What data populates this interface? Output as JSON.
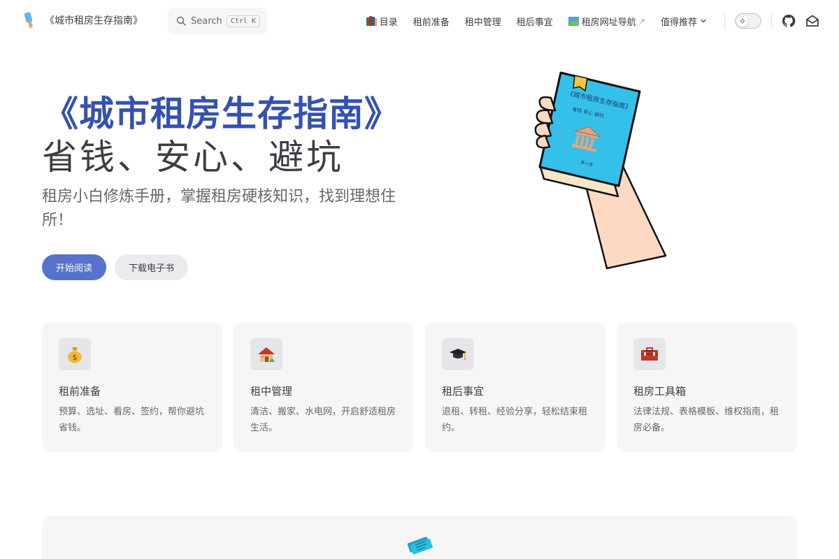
{
  "site": {
    "title": "《城市租房生存指南》"
  },
  "search": {
    "label": "Search",
    "shortcut": "Ctrl K"
  },
  "nav": {
    "items": [
      {
        "label": "目录",
        "icon": "books-emoji-icon"
      },
      {
        "label": "租前准备"
      },
      {
        "label": "租中管理"
      },
      {
        "label": "租后事宜"
      },
      {
        "label": "租房网址导航",
        "icon": "map-emoji-icon",
        "external": "↗"
      },
      {
        "label": "值得推荐",
        "icon": "chevron-down-icon"
      }
    ]
  },
  "hero": {
    "name": "《城市租房生存指南》",
    "text": "省钱、安心、避坑",
    "tagline": "租房小白修炼手册，掌握租房硬核知识，找到理想住所！",
    "actions": [
      {
        "label": "开始阅读"
      },
      {
        "label": "下载电子书"
      }
    ]
  },
  "features": [
    {
      "icon": "money-bag-icon",
      "title": "租前准备",
      "desc": "预算、选址、看房、签约，帮你避坑省钱。"
    },
    {
      "icon": "house-icon",
      "title": "租中管理",
      "desc": "清洁、搬家、水电网，开启舒适租房生活。"
    },
    {
      "icon": "graduation-cap-icon",
      "title": "租后事宜",
      "desc": "退租、转租、经验分享，轻松结束租约。"
    },
    {
      "icon": "toolbox-icon",
      "title": "租房工具箱",
      "desc": "法律法规、表格模板、维权指南，租房必备。"
    }
  ],
  "colors": {
    "brand": "#3451b2",
    "button": "#5672cd",
    "text": "#3c3c43",
    "muted": "#67676c",
    "card_bg": "#f6f6f7"
  }
}
